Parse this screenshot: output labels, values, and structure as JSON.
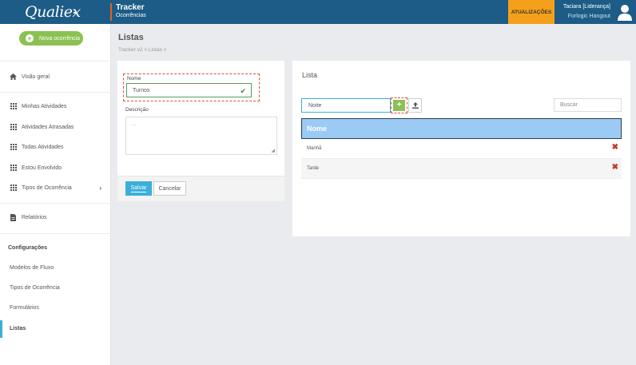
{
  "header": {
    "logo_text": "Qualiex",
    "app_title": "Tracker",
    "app_subtitle": "Ocorrências",
    "updates_label": "ATUALIZAÇÕES",
    "user_name": "Taciara [Liderança]",
    "user_org": "Forlogic Hangout"
  },
  "sidebar": {
    "new_button": "Nova ocorrência",
    "overview": "Visão geral",
    "activities": [
      {
        "label": "Minhas Atividades"
      },
      {
        "label": "Atividades Atrasadas"
      },
      {
        "label": "Todas Atividades"
      },
      {
        "label": "Estou Envolvido"
      },
      {
        "label": "Tipos de Ocorrência"
      }
    ],
    "reports": "Relatórios",
    "config_heading": "Configurações",
    "config_items": [
      {
        "label": "Modelos de Fluxo"
      },
      {
        "label": "Tipos de Ocorrência"
      },
      {
        "label": "Formulários"
      },
      {
        "label": "Listas"
      }
    ]
  },
  "page": {
    "title": "Listas",
    "breadcrumb": "Tracker v2  >  Listas  >"
  },
  "form": {
    "name_label": "Nome",
    "name_value": "Turnos",
    "description_label": "Descrição",
    "description_placeholder": "...",
    "save_label": "Salvar",
    "cancel_label": "Cancelar"
  },
  "list": {
    "title": "Lista",
    "new_item_value": "Noite",
    "add_symbol": "+",
    "search_placeholder": "Buscar",
    "column_header": "Nome",
    "rows": [
      {
        "name": "Manhã"
      },
      {
        "name": "Tarde"
      }
    ]
  },
  "colors": {
    "topbar": "#1c5c86",
    "updates": "#f5a01a",
    "accent_green": "#8cc152",
    "accent_blue": "#3bafda",
    "table_header": "#9bcaf5",
    "delete_red": "#c0392b"
  }
}
